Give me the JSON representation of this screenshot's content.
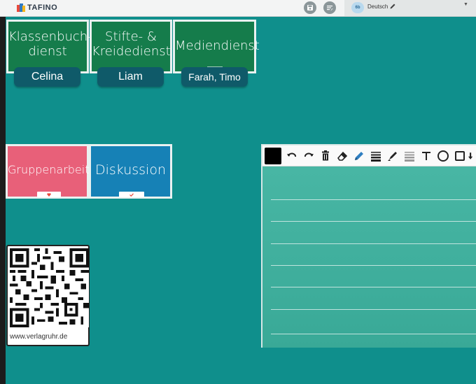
{
  "app": {
    "logo_text": "TAFINO"
  },
  "header": {
    "language": {
      "badge": "6b",
      "label": "Deutsch"
    },
    "icons": [
      "save-icon",
      "menu-icon",
      "pencil-icon",
      "caret-down-icon"
    ]
  },
  "duty_cards": [
    {
      "title_line1": "Klassenbuch-",
      "title_line2": "dienst",
      "name": "Celina"
    },
    {
      "title_line1": "Stifte- &",
      "title_line2": "Kreidedienst",
      "name": "Liam"
    },
    {
      "title_line1": "Mediendienst",
      "title_line2": "",
      "name": "Farah, Timo"
    }
  ],
  "method_cards": [
    {
      "title": "Gruppenarbeit",
      "color": "#e86079"
    },
    {
      "title": "Diskussion",
      "color": "#1681b6"
    }
  ],
  "qr": {
    "url": "www.verlagruhr.de"
  },
  "whiteboard": {
    "pen_color": "#000000",
    "tools": [
      "undo-icon",
      "redo-icon",
      "trash-icon",
      "eraser-icon",
      "pen-icon",
      "line-width-icon",
      "marker-icon",
      "marker-width-icon",
      "text-icon",
      "circle-icon",
      "rectangle-icon",
      "arrow-icon"
    ]
  },
  "colors": {
    "background": "#0f8f8c",
    "duty_card_green": "#157c4b",
    "name_tag": "#0f5a69"
  }
}
